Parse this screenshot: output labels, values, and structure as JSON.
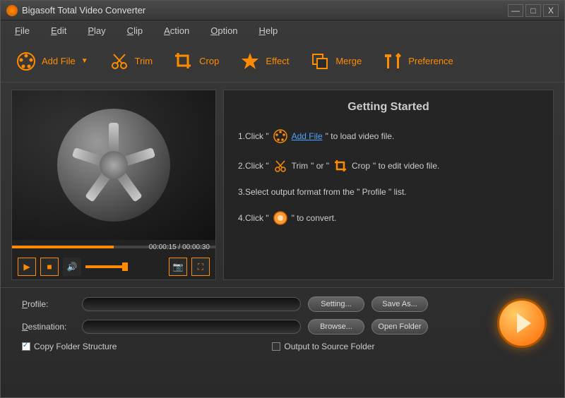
{
  "titlebar": {
    "title": "Bigasoft Total Video Converter"
  },
  "menubar": {
    "items": [
      "File",
      "Edit",
      "Play",
      "Clip",
      "Action",
      "Option",
      "Help"
    ]
  },
  "toolbar": {
    "add_file": "Add File",
    "trim": "Trim",
    "crop": "Crop",
    "effect": "Effect",
    "merge": "Merge",
    "preference": "Preference"
  },
  "preview": {
    "time_current": "00:00:15",
    "time_total": "00:00:30"
  },
  "info": {
    "title": "Getting Started",
    "step1_prefix": "1.Click \"",
    "step1_link": "Add File",
    "step1_suffix": "\" to load video file.",
    "step2_prefix": "2.Click \"",
    "step2_trim": "Trim",
    "step2_or": "\" or \"",
    "step2_crop": "Crop",
    "step2_suffix": "\" to edit video file.",
    "step3": "3.Select output format from the \" Profile \" list.",
    "step4_prefix": "4.Click \"",
    "step4_suffix": "\" to convert."
  },
  "bottom": {
    "profile_label": "Profile:",
    "destination_label": "Destination:",
    "setting_btn": "Setting...",
    "saveas_btn": "Save As...",
    "browse_btn": "Browse...",
    "openfolder_btn": "Open Folder",
    "copy_structure": "Copy Folder Structure",
    "output_source": "Output to Source Folder"
  }
}
